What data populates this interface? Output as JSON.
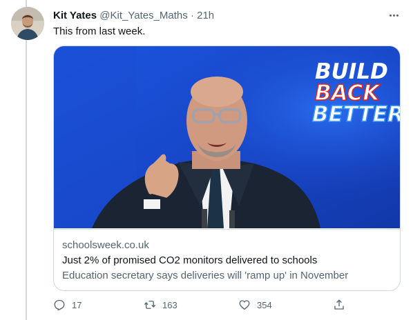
{
  "author": {
    "name": "Kit Yates",
    "handle": "@Kit_Yates_Maths",
    "separator": "·",
    "time": "21h"
  },
  "tweet": {
    "text": "This from last week."
  },
  "card": {
    "domain": "schoolsweek.co.uk",
    "title": "Just 2% of promised CO2 monitors delivered to schools",
    "description": "Education secretary says deliveries will 'ramp up' in November",
    "image_slogan": [
      "BUILD",
      "BACK",
      "BETTER"
    ]
  },
  "actions": {
    "replies": "17",
    "retweets": "163",
    "likes": "354"
  },
  "icons": [
    "avatar",
    "more-icon",
    "reply-icon",
    "retweet-icon",
    "like-icon",
    "share-icon"
  ],
  "colors": {
    "text_primary": "#0f1419",
    "text_secondary": "#536471",
    "border": "#cfd9de",
    "stage_blue": "#1a4fd6",
    "slogan_white": "#ffffff",
    "slogan_red": "#e2231a",
    "slogan_blue": "#3b9bf5"
  }
}
